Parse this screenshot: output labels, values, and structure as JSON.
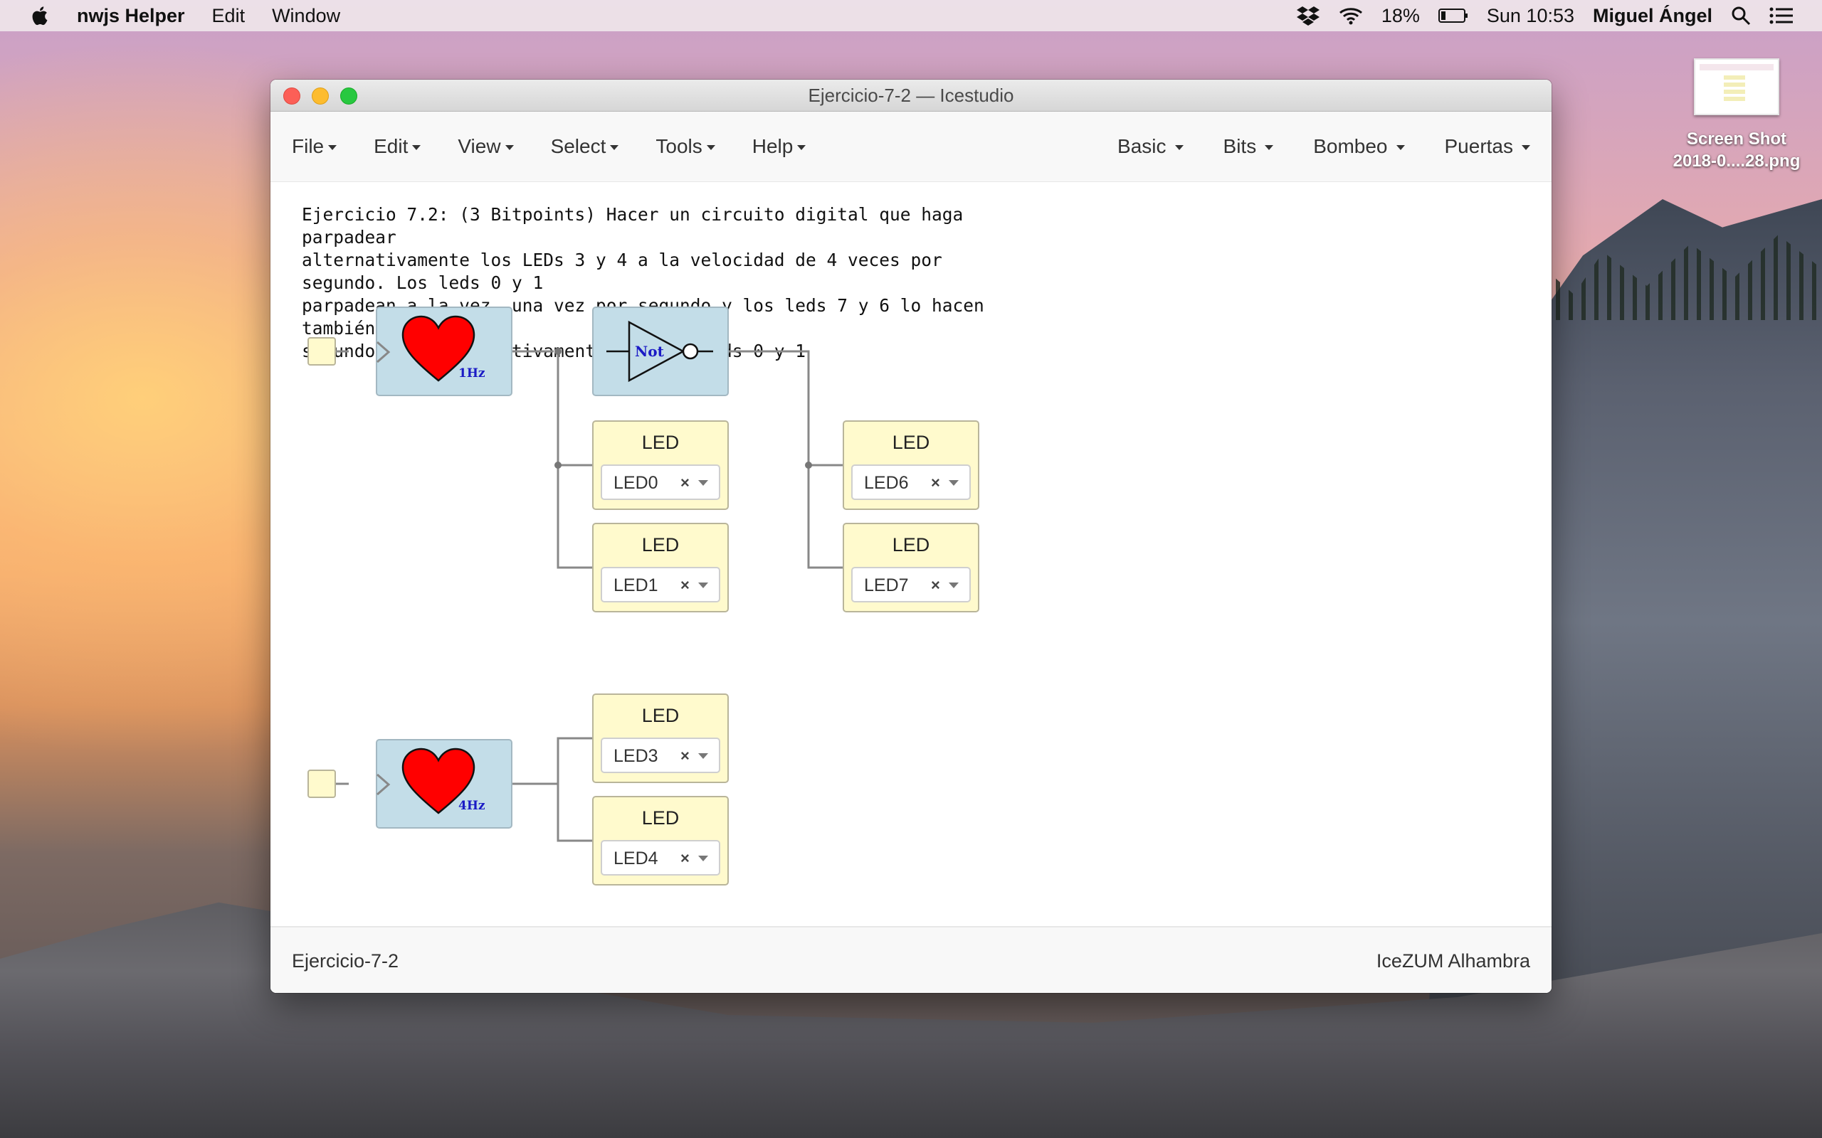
{
  "menubar": {
    "app_name": "nwjs Helper",
    "items": [
      "Edit",
      "Window"
    ],
    "battery": "18%",
    "clock": "Sun 10:53",
    "user": "Miguel Ángel"
  },
  "desktop_icon": {
    "line1": "Screen Shot",
    "line2": "2018-0....28.png"
  },
  "window": {
    "title": "Ejercicio-7-2 — Icestudio"
  },
  "nav": {
    "left": [
      "File",
      "Edit",
      "View",
      "Select",
      "Tools",
      "Help"
    ],
    "right": [
      "Basic",
      "Bits",
      "Bombeo",
      "Puertas"
    ]
  },
  "canvas": {
    "note": "Ejercicio 7.2: (3 Bitpoints) Hacer un circuito digital que haga parpadear\nalternativamente los LEDs 3 y 4 a la velocidad de 4 veces por segundo. Los leds 0 y 1\nparpadean a la vez, una vez por segundo y los leds 7 y 6 lo hacen también una vez por\nsegundo pero alternativamente con los leds 0 y 1",
    "heart_blocks": [
      {
        "freq": "1Hz"
      },
      {
        "freq": "4Hz"
      }
    ],
    "not_label": "Not",
    "leds": [
      {
        "title": "LED",
        "value": "LED0"
      },
      {
        "title": "LED",
        "value": "LED1"
      },
      {
        "title": "LED",
        "value": "LED6"
      },
      {
        "title": "LED",
        "value": "LED7"
      },
      {
        "title": "LED",
        "value": "LED3"
      },
      {
        "title": "LED",
        "value": "LED4"
      }
    ],
    "clear_symbol": "×"
  },
  "footer": {
    "project": "Ejercicio-7-2",
    "board": "IceZUM Alhambra"
  },
  "colors": {
    "block_blue": "#c3dde8",
    "block_yellow": "#fffacd",
    "heart_red": "#ff0000",
    "hz_blue": "#1b1bc5"
  }
}
